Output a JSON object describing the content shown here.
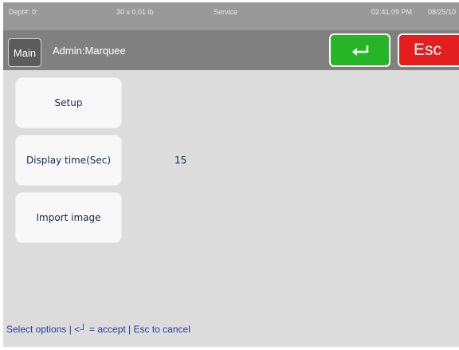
{
  "status_bar": {
    "dept": "Dept#: 0:",
    "scale": "30 x 0.01 lb",
    "mode": "Service",
    "time": "02:41:09 PM",
    "date": "08/25/10"
  },
  "title_bar": {
    "main_label": "Main",
    "title": "Admin:Marquee",
    "enter_icon": "enter-arrow-icon",
    "esc_label": "Esc",
    "enter_color": "#27b527",
    "esc_color": "#e41e1e"
  },
  "options": {
    "setup_label": "Setup",
    "display_time_label": "Display time(Sec)",
    "display_time_value": "15",
    "import_image_label": "Import image"
  },
  "hint": "Select options | <┘ = accept | Esc to cancel"
}
